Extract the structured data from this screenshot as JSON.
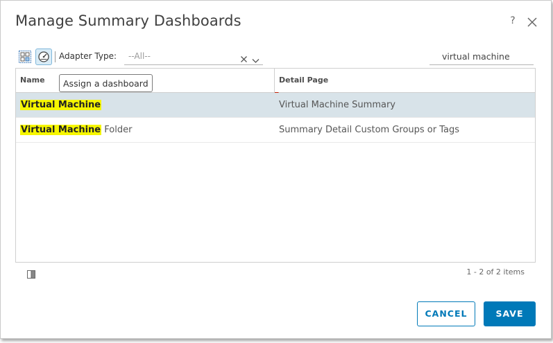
{
  "dialog": {
    "title": "Manage Summary Dashboards",
    "help_label": "?"
  },
  "toolbar": {
    "adapter_type_label": "Adapter Type:",
    "adapter_type_value": "--All--",
    "search_value": "virtual machine",
    "icons": [
      "grid-view-icon",
      "gauge-dashboard-icon",
      "clear-icon",
      "chevron-down-icon"
    ]
  },
  "tooltip": {
    "text": "Assign a dashboard"
  },
  "grid": {
    "columns": {
      "name": "Name",
      "detail": "Detail Page"
    },
    "rows": [
      {
        "name_highlight": "Virtual Machine",
        "name_rest": "",
        "detail": "Virtual Machine Summary",
        "selected": true
      },
      {
        "name_highlight": "Virtual Machine",
        "name_rest": " Folder",
        "detail": "Summary Detail Custom Groups or Tags",
        "selected": false
      }
    ]
  },
  "footer": {
    "pager_text": "1 - 2 of 2 items",
    "cancel_label": "CANCEL",
    "save_label": "SAVE"
  },
  "colors": {
    "accent": "#0079b8",
    "highlight": "#f6f600",
    "selected_row": "#d8e3e9"
  }
}
